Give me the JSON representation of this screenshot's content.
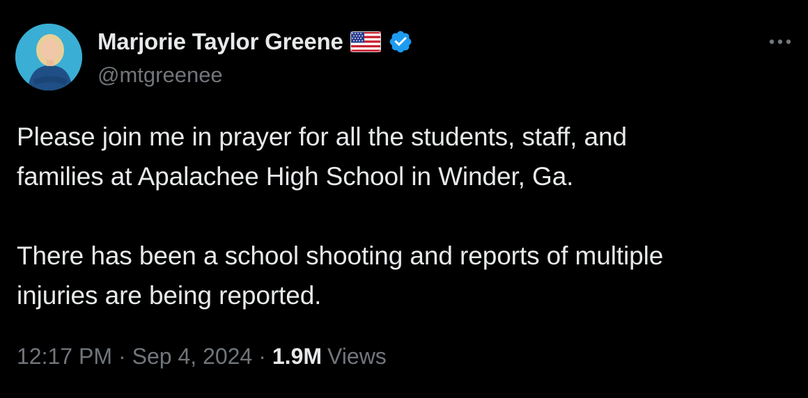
{
  "author": {
    "display_name": "Marjorie Taylor Greene",
    "handle": "@mtgreenee",
    "flag_icon": "us-flag-icon",
    "verified_icon": "verified-badge-icon",
    "verified_color": "#1d9bf0"
  },
  "more_icon": "ellipsis-icon",
  "tweet": {
    "paragraphs": [
      [
        "Please join me in prayer for all the students, staff, and",
        "families at Apalachee High School in Winder, Ga."
      ],
      [
        "There has been a school shooting and reports of multiple",
        "injuries are being reported."
      ]
    ],
    "p1_line1": "Please join me in prayer for all the students, staff, and",
    "p1_line2": "families at Apalachee High School in Winder, Ga.",
    "p2_line1": "There has been a school shooting and reports of multiple",
    "p2_line2": "injuries are being reported."
  },
  "meta": {
    "time": "12:17 PM",
    "separator": "·",
    "date": "Sep 4, 2024",
    "views_count": "1.9M",
    "views_label": "Views"
  },
  "colors": {
    "background": "#000000",
    "primary_text": "#e7e9ea",
    "secondary_text": "#71767b"
  }
}
